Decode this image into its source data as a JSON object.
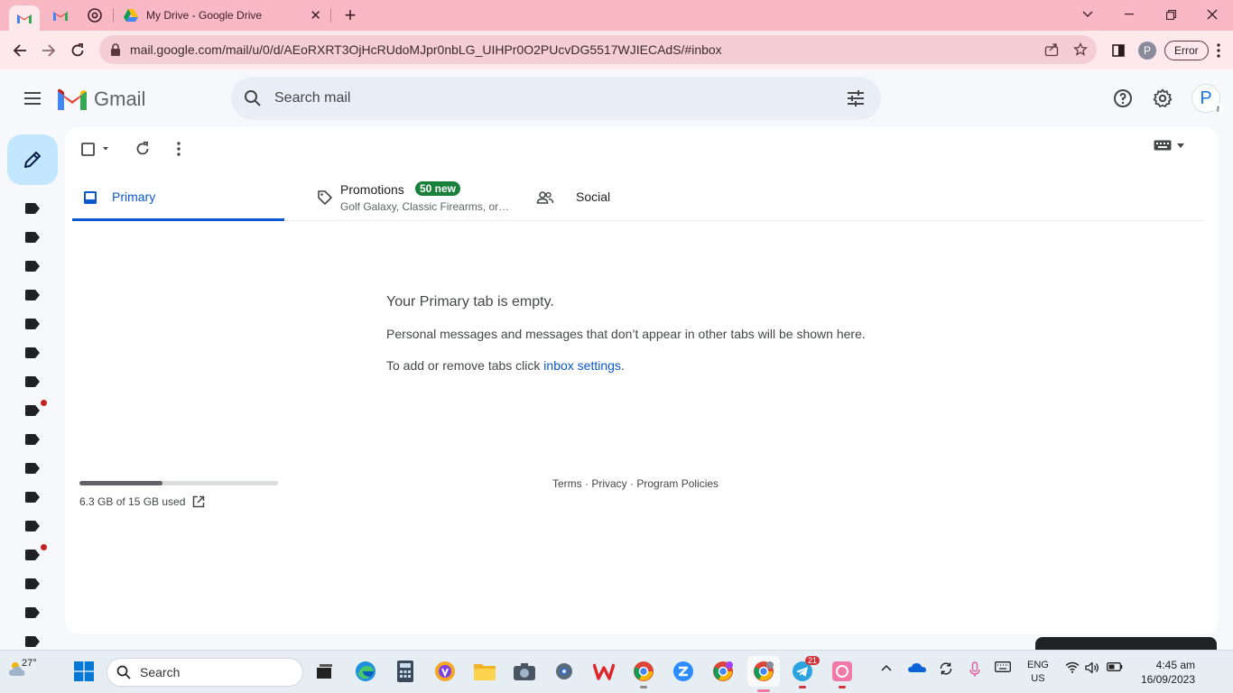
{
  "browser": {
    "tab_title": "My Drive - Google Drive",
    "url": "mail.google.com/mail/u/0/d/AEoRXRT3OjHcRUdoMJpr0nbLG_UIHPr0O2PUcvDG5517WJIECAdS/#inbox",
    "profile_initial": "P",
    "error_label": "Error",
    "theme_color": "#f8b8c4"
  },
  "gmail": {
    "brand": "Gmail",
    "search_placeholder": "Search mail",
    "avatar_initial": "P",
    "tabs": {
      "primary": "Primary",
      "promotions": "Promotions",
      "promotions_badge": "50 new",
      "promotions_snippet": "Golf Galaxy, Classic Firearms, or…",
      "social": "Social"
    },
    "empty": {
      "title": "Your Primary tab is empty.",
      "line1": "Personal messages and messages that don’t appear in other tabs will be shown here.",
      "line2_prefix": "To add or remove tabs click ",
      "line2_link": "inbox settings",
      "line2_suffix": "."
    },
    "storage": {
      "used_text": "6.3 GB of 15 GB used",
      "used_fraction": 0.42
    },
    "footer": {
      "terms": "Terms",
      "privacy": "Privacy",
      "policies": "Program Policies",
      "sep": " · "
    },
    "accent": "#0b57d0",
    "badge_color": "#188038"
  },
  "taskbar": {
    "weather": "27°",
    "search_label": "Search",
    "telegram_badge": "21",
    "lang_top": "ENG",
    "lang_bottom": "US",
    "time": "4:45 am",
    "date": "16/09/2023"
  }
}
